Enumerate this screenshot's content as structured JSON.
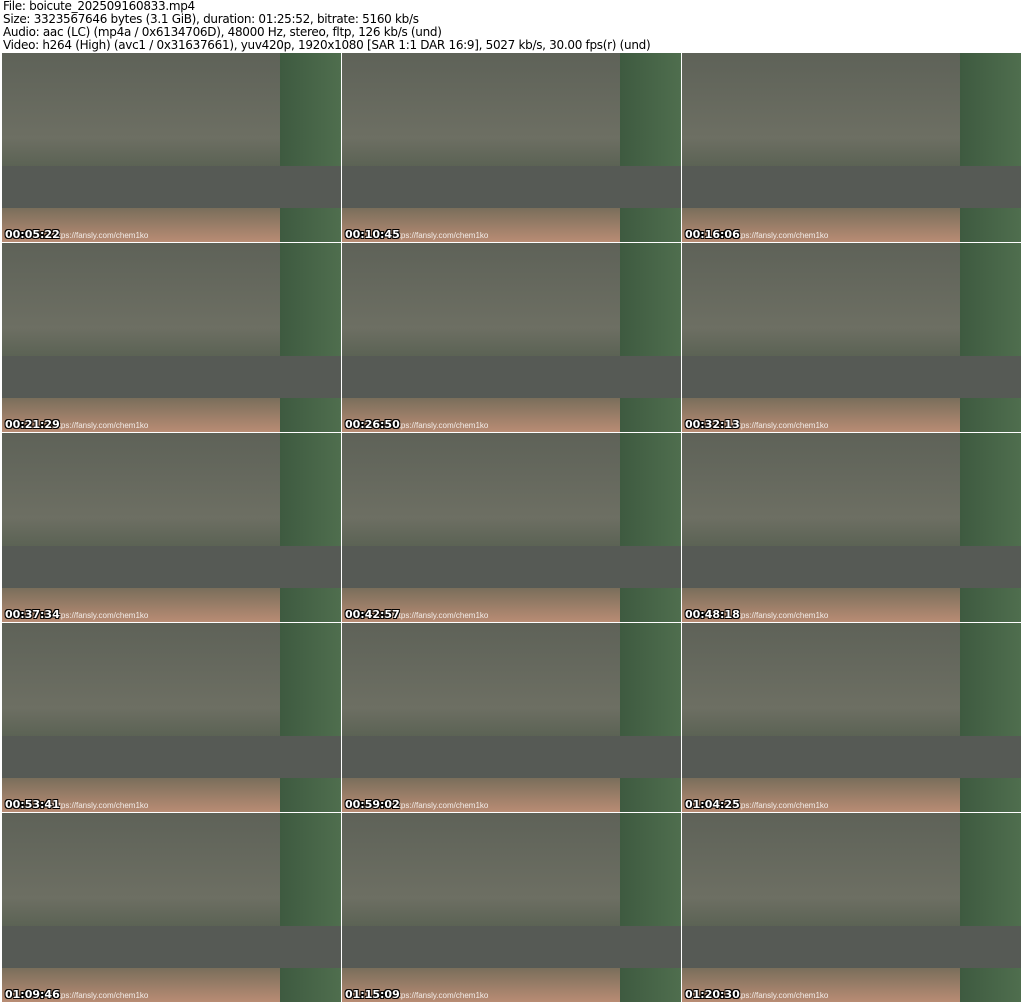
{
  "header": {
    "file": "File: boicute_202509160833.mp4",
    "size": "Size: 3323567646 bytes (3.1 GiB), duration: 01:25:52, bitrate: 5160 kb/s",
    "audio": "Audio: aac (LC) (mp4a / 0x6134706D), 48000 Hz, stereo, fltp, 126 kb/s (und)",
    "video": "Video: h264 (High) (avc1 / 0x31637661), yuv420p, 1920x1080 [SAR 1:1 DAR 16:9], 5027 kb/s, 30.00 fps(r) (und)"
  },
  "watermark": "https://fansly.com/chem1ko",
  "thumbnails": [
    {
      "timestamp": "00:05:22"
    },
    {
      "timestamp": "00:10:45"
    },
    {
      "timestamp": "00:16:06"
    },
    {
      "timestamp": "00:21:29"
    },
    {
      "timestamp": "00:26:50"
    },
    {
      "timestamp": "00:32:13"
    },
    {
      "timestamp": "00:37:34"
    },
    {
      "timestamp": "00:42:57"
    },
    {
      "timestamp": "00:48:18"
    },
    {
      "timestamp": "00:53:41"
    },
    {
      "timestamp": "00:59:02"
    },
    {
      "timestamp": "01:04:25"
    },
    {
      "timestamp": "01:09:46"
    },
    {
      "timestamp": "01:15:09"
    },
    {
      "timestamp": "01:20:30"
    }
  ]
}
